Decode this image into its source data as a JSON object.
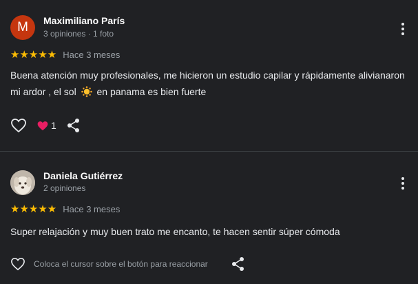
{
  "reviews": [
    {
      "avatar_letter": "M",
      "avatar_color": "#c5360f",
      "name": "Maximiliano París",
      "meta": "3 opiniones · 1 foto",
      "stars": "★★★★★",
      "rating": 5,
      "time": "Hace 3 meses",
      "text_before": "Buena atención muy profesionales, me hicieron un estudio capilar y rápidamente alivianaron mi ardor , el sol",
      "text_after": "en panama es bien fuerte",
      "reaction_count": "1"
    },
    {
      "name": "Daniela Gutiérrez",
      "meta": "2 opiniones",
      "stars": "★★★★★",
      "rating": 5,
      "time": "Hace 3 meses",
      "text": "Super relajación y muy buen trato me encanto, te hacen sentir súper cómoda",
      "react_hint": "Coloca el cursor sobre el botón para reaccionar"
    }
  ],
  "colors": {
    "background": "#202124",
    "star": "#fbbc04",
    "heart": "#e91e63"
  }
}
